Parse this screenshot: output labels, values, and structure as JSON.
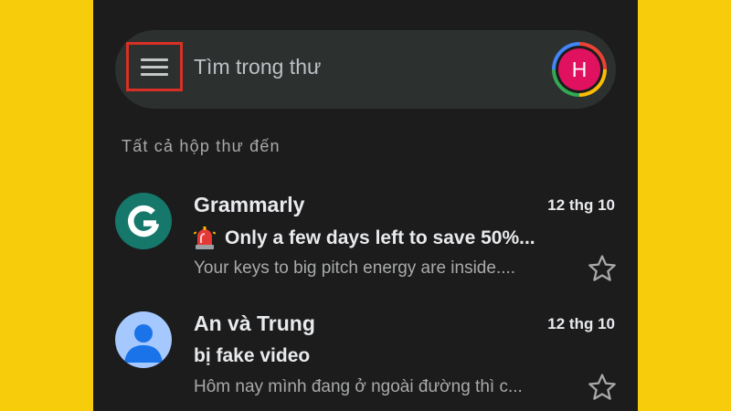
{
  "search": {
    "placeholder": "Tìm trong thư",
    "avatar_letter": "H"
  },
  "section_label": "Tất cả hộp thư đến",
  "emails": [
    {
      "sender": "Grammarly",
      "date": "12 thg 10",
      "subject": "Only a few days left to save 50%...",
      "subject_icon": "siren-emoji",
      "snippet": "Your keys to big pitch energy are inside....",
      "avatar_icon": "grammarly-logo-icon",
      "starred": false
    },
    {
      "sender": "An và Trung",
      "date": "12 thg 10",
      "subject": "bị fake video",
      "snippet": "Hôm nay mình đang ở ngoài đường thì c...",
      "avatar_icon": "person-icon",
      "starred": false
    }
  ],
  "colors": {
    "background": "#F7CC0A",
    "app_background": "#1C1C1C",
    "search_bar": "#2C302F",
    "highlight_box": "#D93025",
    "account_avatar": "#E0115F",
    "grammarly_green": "#15786B",
    "person_avatar": "#A5C8FF"
  }
}
